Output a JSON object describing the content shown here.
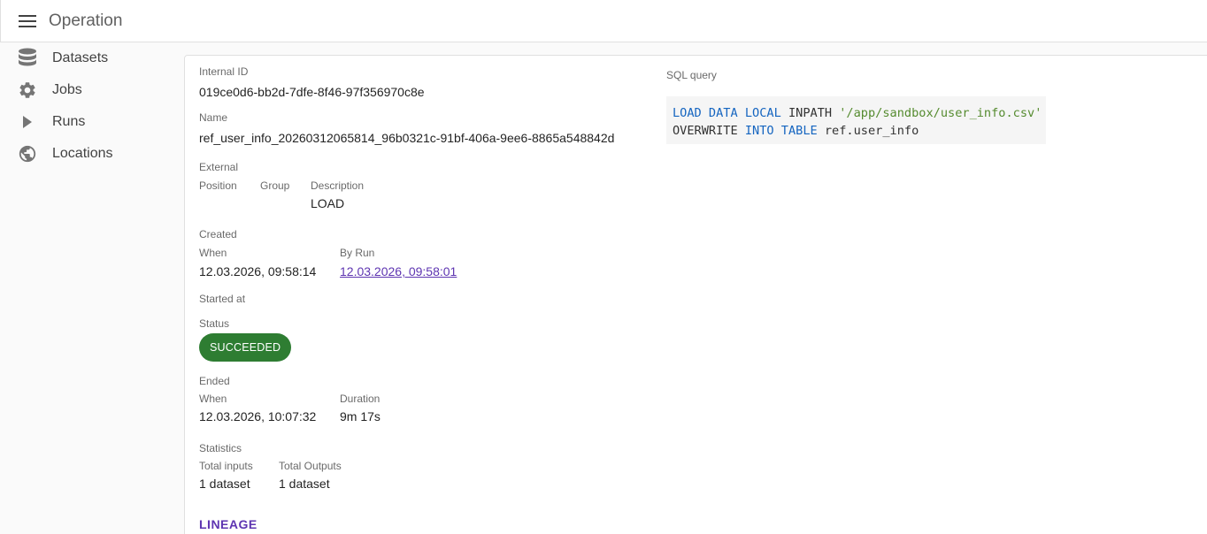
{
  "header": {
    "title": "Operation"
  },
  "sidebar": {
    "items": [
      {
        "label": "Datasets",
        "icon": "database-icon"
      },
      {
        "label": "Jobs",
        "icon": "gear-icon"
      },
      {
        "label": "Runs",
        "icon": "play-icon"
      },
      {
        "label": "Locations",
        "icon": "globe-icon"
      }
    ]
  },
  "operation": {
    "internal_id_label": "Internal ID",
    "internal_id": "019ce0d6-bb2d-7dfe-8f46-97f356970c8e",
    "name_label": "Name",
    "name": "ref_user_info_20260312065814_96b0321c-91bf-406a-9ee6-8865a548842d",
    "external_label": "External",
    "position_label": "Position",
    "group_label": "Group",
    "description_label": "Description",
    "description": "LOAD",
    "created_label": "Created",
    "created_when_label": "When",
    "created_when": "12.03.2026, 09:58:14",
    "by_run_label": "By Run",
    "by_run": "12.03.2026, 09:58:01",
    "started_label": "Started at",
    "status_label": "Status",
    "status": "SUCCEEDED",
    "ended_label": "Ended",
    "ended_when_label": "When",
    "ended_when": "12.03.2026, 10:07:32",
    "duration_label": "Duration",
    "duration": "9m 17s",
    "statistics_label": "Statistics",
    "total_inputs_label": "Total inputs",
    "total_inputs": "1 dataset",
    "total_outputs_label": "Total Outputs",
    "total_outputs": "1 dataset",
    "lineage_label": "LINEAGE"
  },
  "sql": {
    "label": "SQL query",
    "line1": {
      "kw1": "LOAD DATA LOCAL",
      "plain1": " INPATH ",
      "str": "'/app/sandbox/user_info.csv'"
    },
    "line2": {
      "plain1": "OVERWRITE ",
      "kw1": "INTO TABLE",
      "plain2": " ref.user_info"
    }
  },
  "colors": {
    "accent": "#5e35b1",
    "success": "#2e7d32",
    "keyword": "#1565c0",
    "string": "#558b2f"
  }
}
